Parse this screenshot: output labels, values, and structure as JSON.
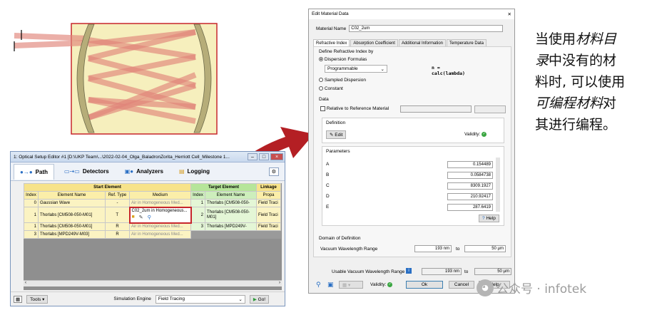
{
  "ose": {
    "title": "1: Optical Setup Editor #1 [D:\\UKP Team\\...\\2022-02-04_Olga_BaladronZorita_Herriott Cell_Milestone 1...",
    "tabs": [
      "Path",
      "Detectors",
      "Analyzers",
      "Logging"
    ],
    "group_start": "Start Element",
    "group_target": "Target Element",
    "group_linkage": "Linkage",
    "cols": [
      "Index",
      "Element Name",
      "Ref. Type",
      "Medium",
      "Index",
      "Element Name",
      "Propa"
    ],
    "rows": [
      {
        "idx": "0",
        "name": "Gaussian Wave",
        "ref": "-",
        "medium": "Air in Homogeneous Med...",
        "tidx": "1",
        "tname": "Thorlabs [CM508-050-",
        "prop": "Field Traci"
      },
      {
        "idx": "1",
        "name": "Thorlabs [CM508-050-M01]",
        "ref": "T",
        "medium": "C02_2um in Homogeneous...",
        "tidx": "2",
        "tname": "Thorlabs [CM508-050-M01]",
        "prop": "Field Traci"
      },
      {
        "idx": "1",
        "name": "Thorlabs [CM508-050-M01]",
        "ref": "R",
        "medium": "Air in Homogeneous Med...",
        "tidx": "3",
        "tname": "Thorlabs [MPD249V-",
        "prop": "Field Traci"
      },
      {
        "idx": "3",
        "name": "Thorlabs [MPD249V-M03]",
        "ref": "R",
        "medium": "Air in Homogeneous Med...",
        "tidx": "",
        "tname": "",
        "prop": ""
      }
    ],
    "tools_label": "Tools",
    "sim_engine_label": "Simulation Engine",
    "sim_engine_value": "Field Tracing",
    "go_label": "Go!"
  },
  "emd": {
    "title": "Edit Material Data",
    "material_name_label": "Material Name",
    "material_name": "C02_2um",
    "tabs": [
      "Refractive Index",
      "Absorption Coefficient",
      "Additional Information",
      "Temperature Data"
    ],
    "define_by": "Define Refractive Index by",
    "options": [
      "Dispersion Formulas",
      "Sampled Dispersion",
      "Constant"
    ],
    "formula_select": "Programmable",
    "formula_text": "n =\ncalc(lambda)",
    "data_label": "Data",
    "relative_label": "Relative to Reference Material",
    "definition_label": "Definition",
    "edit_label": "Edit",
    "validity_label": "Validity:",
    "parameters_label": "Parameters",
    "params": [
      {
        "name": "A",
        "value": "0.154489"
      },
      {
        "name": "B",
        "value": "0.0584738"
      },
      {
        "name": "C",
        "value": "8309.1927"
      },
      {
        "name": "D",
        "value": "210.92417"
      },
      {
        "name": "E",
        "value": "287.6419"
      }
    ],
    "help_label": "Help",
    "domain_label": "Domain of Definition",
    "vwr_label": "Vacuum Wavelength Range",
    "vwr_min": "193 nm",
    "vwr_to": "to",
    "vwr_max": "50 µm",
    "usable_label": "Usable Vacuum Wavelength Range",
    "usable_min": "193 nm",
    "usable_to": "to",
    "usable_max": "50 µm",
    "ok_label": "Ok",
    "cancel_label": "Cancel",
    "help2_label": "Help"
  },
  "zh": {
    "l1a": "当使用",
    "l1b": "材料目",
    "l2a": "录",
    "l2b": "中没有的材",
    "l3": "料时, 可以使用",
    "l4a": "可编程材料",
    "l4b": "对",
    "l5": "其进行编程。"
  },
  "watermark": "公众号 · infotek",
  "colors": {
    "cell_fill": "#f6efbd",
    "beam": "#e0847a",
    "highlight": "#c7262c",
    "arrow": "#b41f24"
  }
}
